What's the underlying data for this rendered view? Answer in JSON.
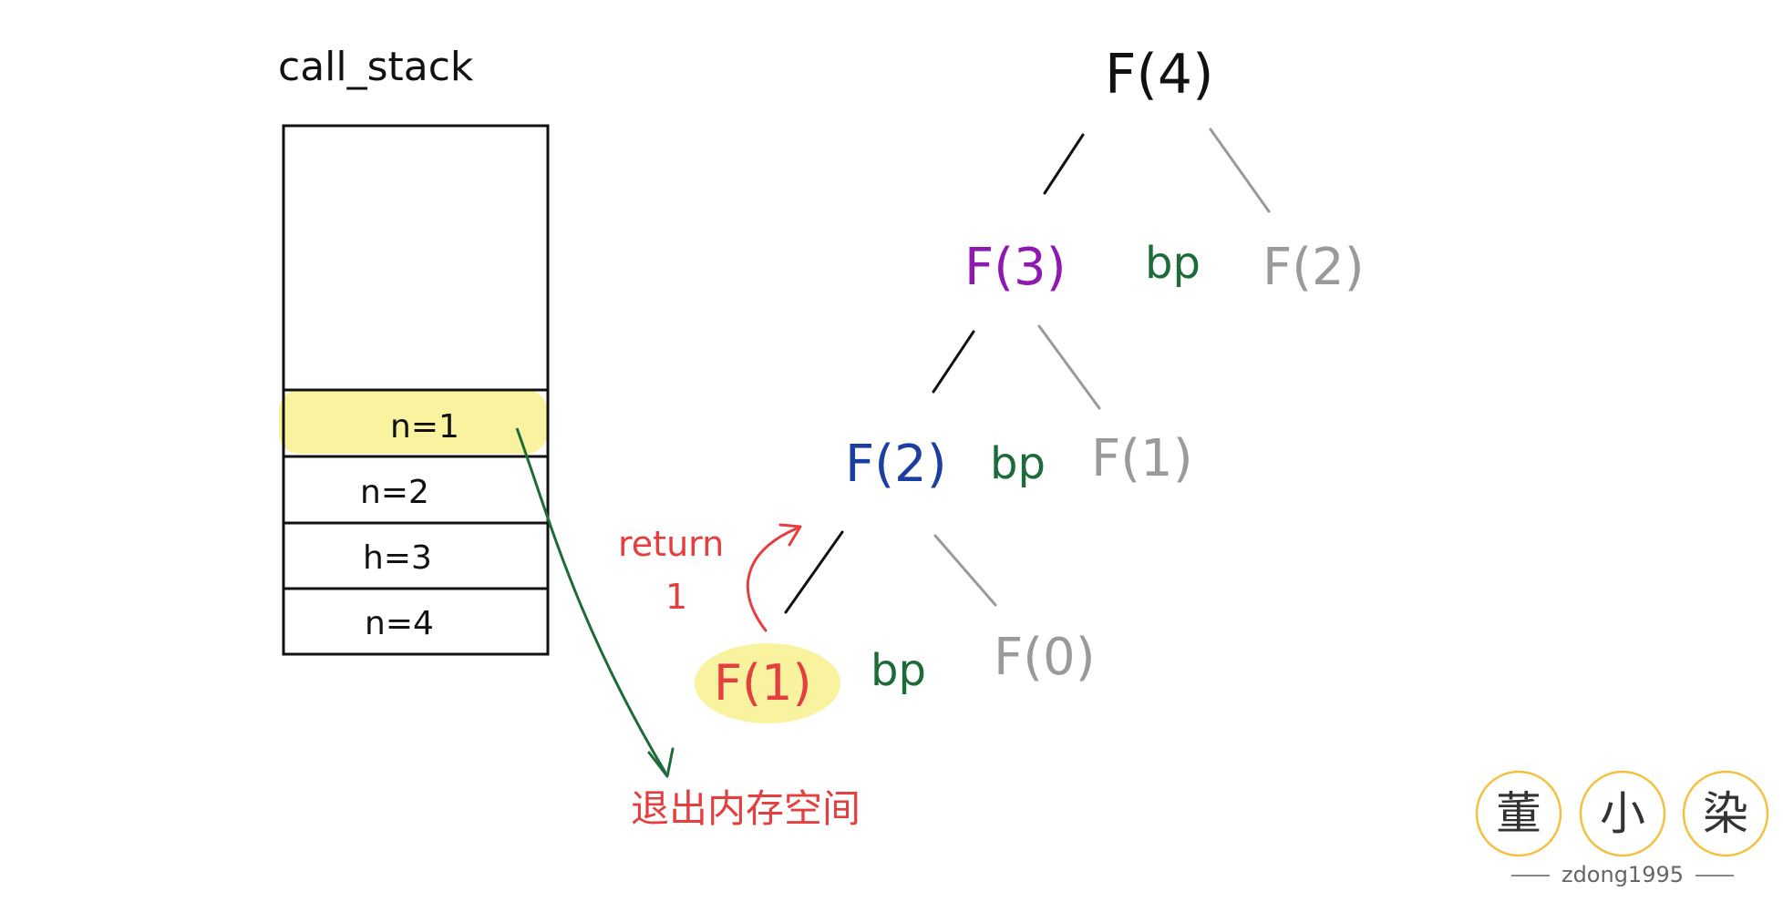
{
  "stack": {
    "title": "call_stack",
    "frames": [
      "n=1",
      "n=2",
      "h=3",
      "n=4"
    ],
    "highlight_color": "#f9f3a0"
  },
  "tree": {
    "root": "F(4)",
    "level1": {
      "left": "F(3)",
      "mid": "bp",
      "right": "F(2)"
    },
    "level2": {
      "left": "F(2)",
      "mid": "bp",
      "right": "F(1)"
    },
    "level3": {
      "left": "F(1)",
      "mid": "bp",
      "right": "F(0)"
    }
  },
  "annotations": {
    "return_word": "return",
    "return_value": "1",
    "exit_memory": "退出内存空间"
  },
  "watermark": {
    "chars": [
      "董",
      "小",
      "染"
    ],
    "handle": "zdong1995",
    "ring_color": "#f5c040"
  },
  "colors": {
    "ink": "#111111",
    "purple": "#8e18b0",
    "blue": "#1c3ea0",
    "green": "#1e6b3a",
    "gray": "#9a9a9a",
    "red": "#e53e3e",
    "highlight": "#f9f3a0"
  }
}
